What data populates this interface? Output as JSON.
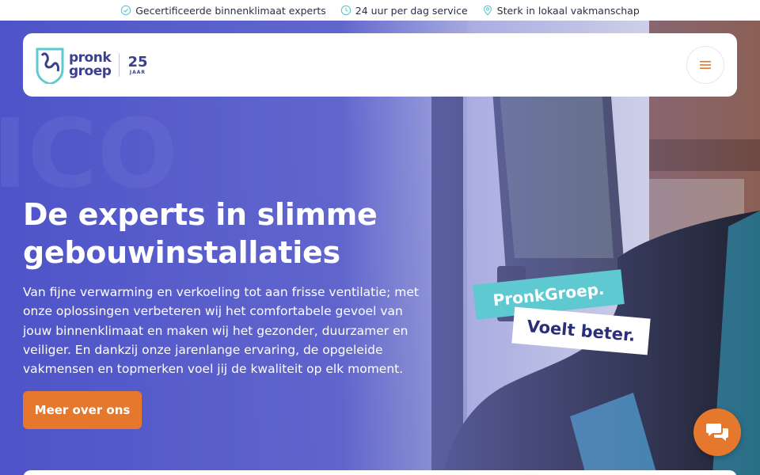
{
  "usp_bar": {
    "items": [
      {
        "icon": "check-badge-icon",
        "label": "Gecertificeerde binnenklimaat experts"
      },
      {
        "icon": "clock-icon",
        "label": "24 uur per dag service"
      },
      {
        "icon": "location-pin-icon",
        "label": "Sterk in lokaal vakmanschap"
      }
    ]
  },
  "header": {
    "logo": {
      "line1": "pronk",
      "line2": "groep",
      "anniversary_number": "25",
      "anniversary_label": "JAAR"
    },
    "menu_icon": "hamburger-icon"
  },
  "hero": {
    "title_line1": "De experts in slimme",
    "title_line2": "gebouwinstallaties",
    "description": "Van fijne verwarming en verkoeling tot aan frisse ventilatie; met onze oplossingen verbeteren wij het comfortabele gevoel van jouw binnenklimaat en maken wij het gezonder, duurzamer en veiliger. En dankzij onze jarenlange ervaring, de opgeleide vakmensen en topmerken voel jij de kwaliteit op elk moment.",
    "cta_label": "Meer over ons",
    "sticker_1": "PronkGroep.",
    "sticker_2": "Voelt beter."
  },
  "chat": {
    "icon": "chat-bubbles-icon"
  },
  "colors": {
    "accent": "#e5782c",
    "brand_navy": "#3a3f8f",
    "teal": "#5ec9d0",
    "hero_overlay": "#5a5fc7"
  }
}
